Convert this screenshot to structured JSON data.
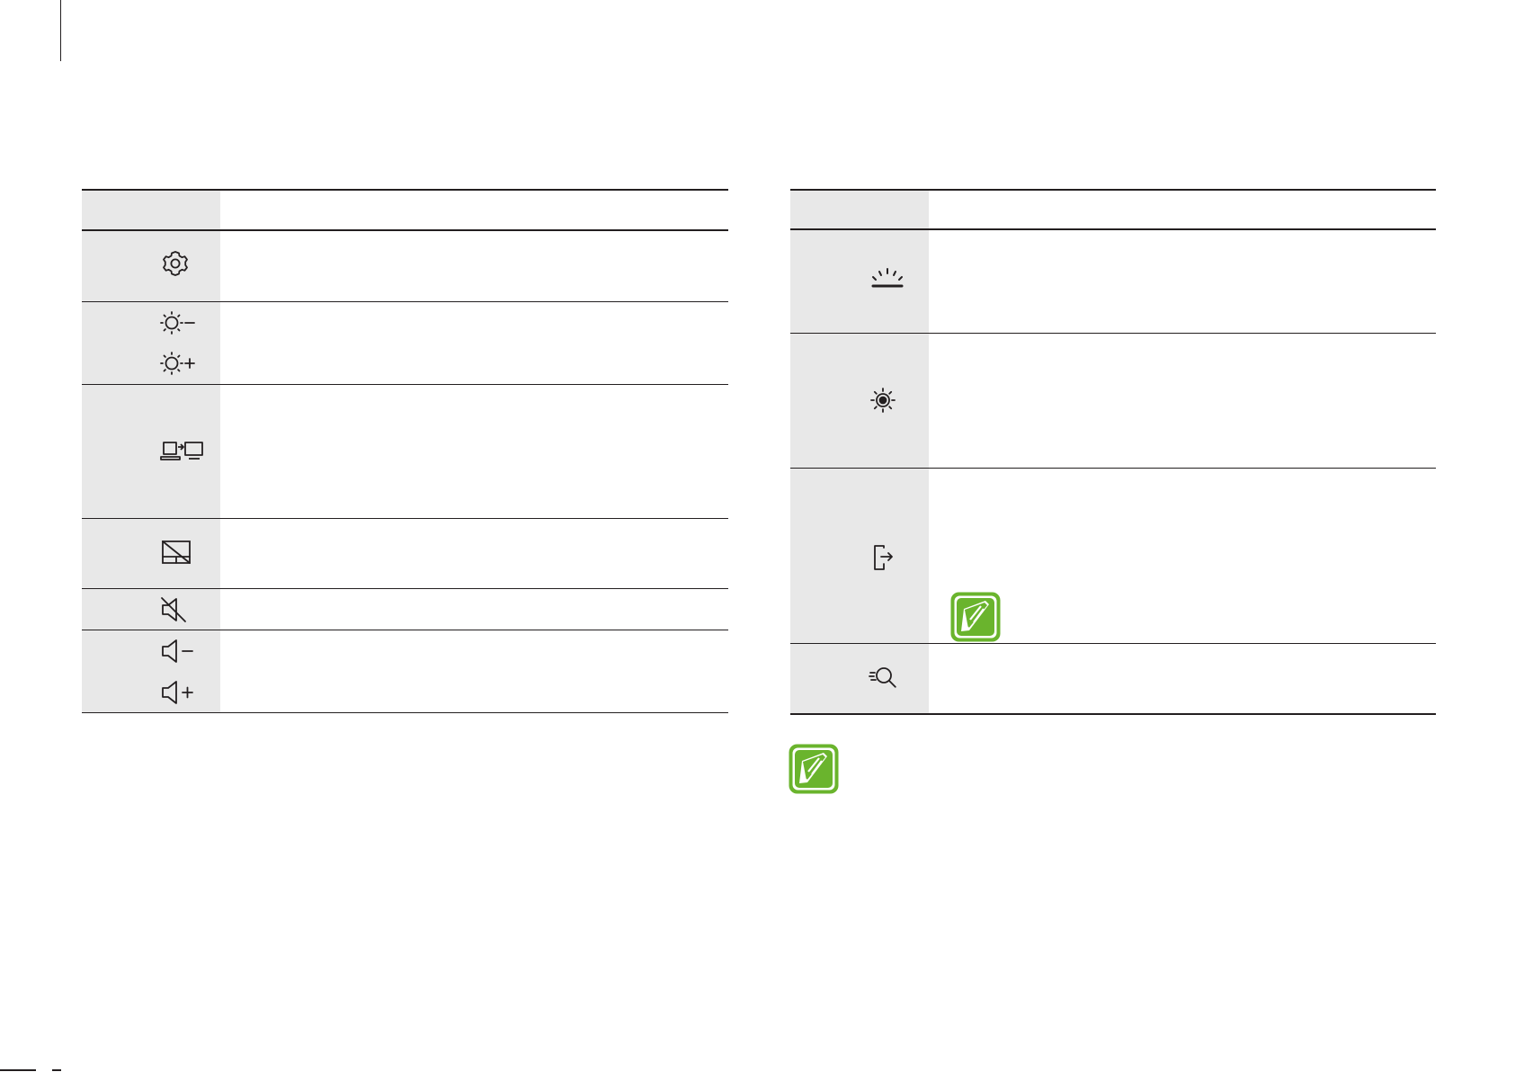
{
  "left_table": {
    "header": {
      "key": "",
      "description": ""
    },
    "rows": [
      {
        "icons": [
          "settings-icon"
        ],
        "description": ""
      },
      {
        "icons": [
          "brightness-down-icon",
          "brightness-up-icon"
        ],
        "description": ""
      },
      {
        "icons": [
          "display-switch-icon"
        ],
        "description": ""
      },
      {
        "icons": [
          "touchpad-off-icon"
        ],
        "description": ""
      },
      {
        "icons": [
          "mute-icon"
        ],
        "description": ""
      },
      {
        "icons": [
          "volume-down-icon",
          "volume-up-icon"
        ],
        "description": ""
      }
    ]
  },
  "right_table": {
    "header": {
      "key": "",
      "description": ""
    },
    "rows": [
      {
        "icons": [
          "keyboard-backlight-icon"
        ],
        "description": ""
      },
      {
        "icons": [
          "performance-mode-icon"
        ],
        "description": ""
      },
      {
        "icons": [
          "phone-link-icon"
        ],
        "description": "",
        "note_icon": "note-pencil-icon"
      },
      {
        "icons": [
          "quick-search-icon"
        ],
        "description": ""
      }
    ]
  },
  "note": {
    "icon": "note-pencil-icon",
    "text": ""
  },
  "colors": {
    "rule": "#231f20",
    "key_cell": "#e8e8e8",
    "note_green": "#6ab42d"
  }
}
